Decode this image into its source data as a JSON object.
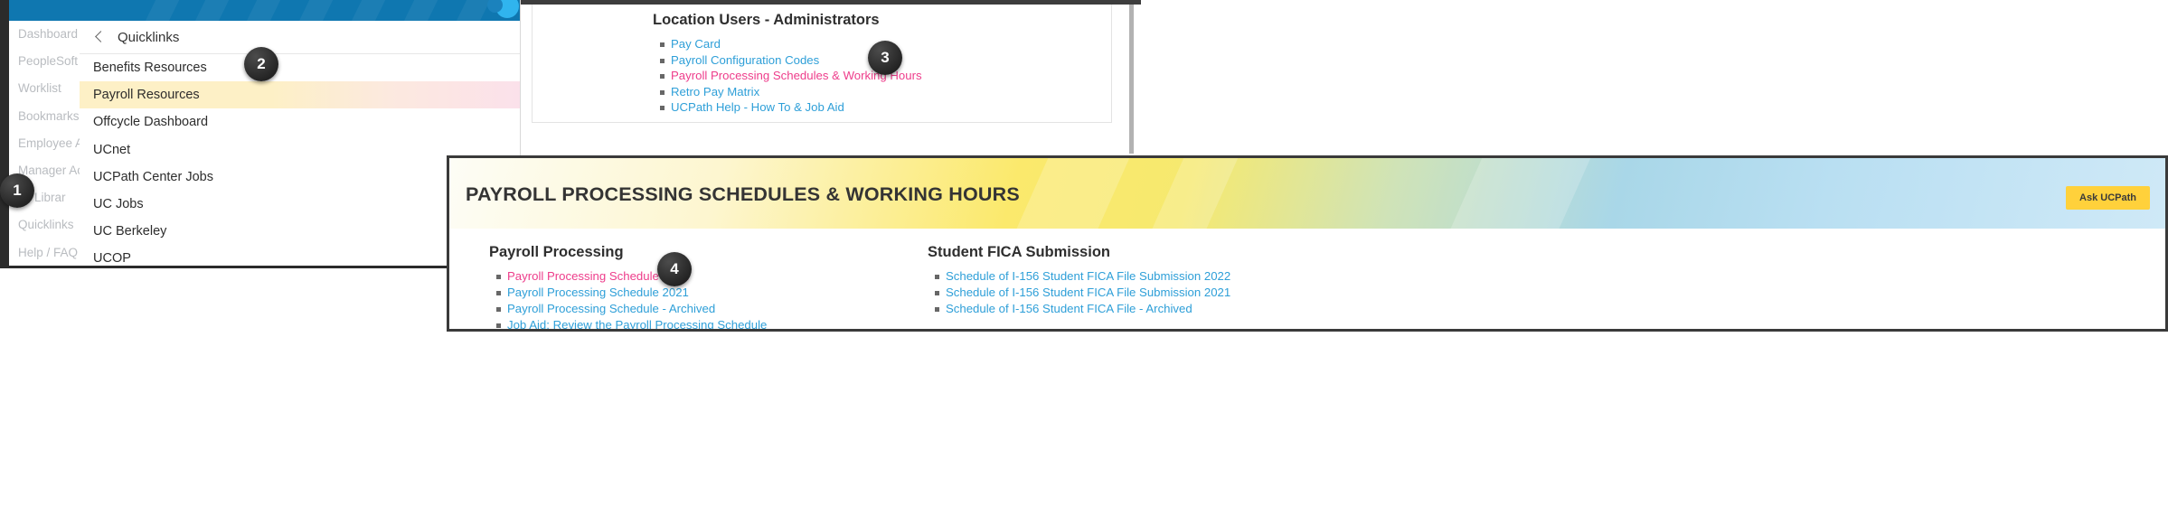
{
  "quicklinks_panel": {
    "background_nav": {
      "items": [
        {
          "label": "Dashboard"
        },
        {
          "label": "PeopleSoft M"
        },
        {
          "label": "Worklist"
        },
        {
          "label": "Bookmarks"
        },
        {
          "label": "Employee Ac"
        },
        {
          "label": "Manager Act"
        },
        {
          "label": "ns Librar"
        },
        {
          "label": "Quicklinks"
        },
        {
          "label": "Help / FAQ"
        }
      ]
    },
    "flyout": {
      "title": "Quicklinks",
      "back_icon": "chevron-left-icon",
      "items": [
        {
          "label": "Benefits Resources",
          "selected": false
        },
        {
          "label": "Payroll Resources",
          "selected": true
        },
        {
          "label": "Offcycle Dashboard",
          "selected": false
        },
        {
          "label": "UCnet",
          "selected": false
        },
        {
          "label": "UCPath Center Jobs",
          "selected": false
        },
        {
          "label": "UC Jobs",
          "selected": false
        },
        {
          "label": "UC Berkeley",
          "selected": false
        },
        {
          "label": "UCOP",
          "selected": false
        }
      ]
    },
    "topbar": {
      "search_icon": "search-icon",
      "background_color": "#0f77b0"
    }
  },
  "location_panel": {
    "title": "Location Users - Administrators",
    "links": [
      {
        "label": "Pay Card",
        "highlighted": false
      },
      {
        "label": "Payroll Configuration Codes",
        "highlighted": false
      },
      {
        "label": "Payroll Processing Schedules & Working Hours",
        "highlighted": true
      },
      {
        "label": "Retro Pay Matrix",
        "highlighted": false
      },
      {
        "label": "UCPath Help - How To & Job Aid",
        "highlighted": false
      }
    ]
  },
  "payroll_panel": {
    "page_title": "PAYROLL PROCESSING SCHEDULES & WORKING HOURS",
    "ask_button_label": "Ask UCPath",
    "columns": [
      {
        "heading": "Payroll Processing",
        "links": [
          {
            "label": "Payroll Processing Schedule 2022",
            "highlighted": true
          },
          {
            "label": "Payroll Processing Schedule 2021",
            "highlighted": false
          },
          {
            "label": "Payroll Processing Schedule - Archived",
            "highlighted": false
          },
          {
            "label": "Job Aid: Review the Payroll Processing Schedule",
            "highlighted": false
          }
        ]
      },
      {
        "heading": "Student FICA Submission",
        "links": [
          {
            "label": "Schedule of I-156 Student FICA File Submission 2022",
            "highlighted": false
          },
          {
            "label": "Schedule of I-156 Student FICA File Submission 2021",
            "highlighted": false
          },
          {
            "label": "Schedule of I-156 Student FICA File - Archived",
            "highlighted": false
          }
        ]
      }
    ]
  },
  "callouts": [
    {
      "number": "1"
    },
    {
      "number": "2"
    },
    {
      "number": "3"
    },
    {
      "number": "4"
    }
  ],
  "colors": {
    "header_blue": "#0f77b0",
    "link_blue": "#2e9fd8",
    "link_pink": "#ee3d8b",
    "accent_yellow": "#ffd13b",
    "selected_row": "#fdf0c6"
  }
}
